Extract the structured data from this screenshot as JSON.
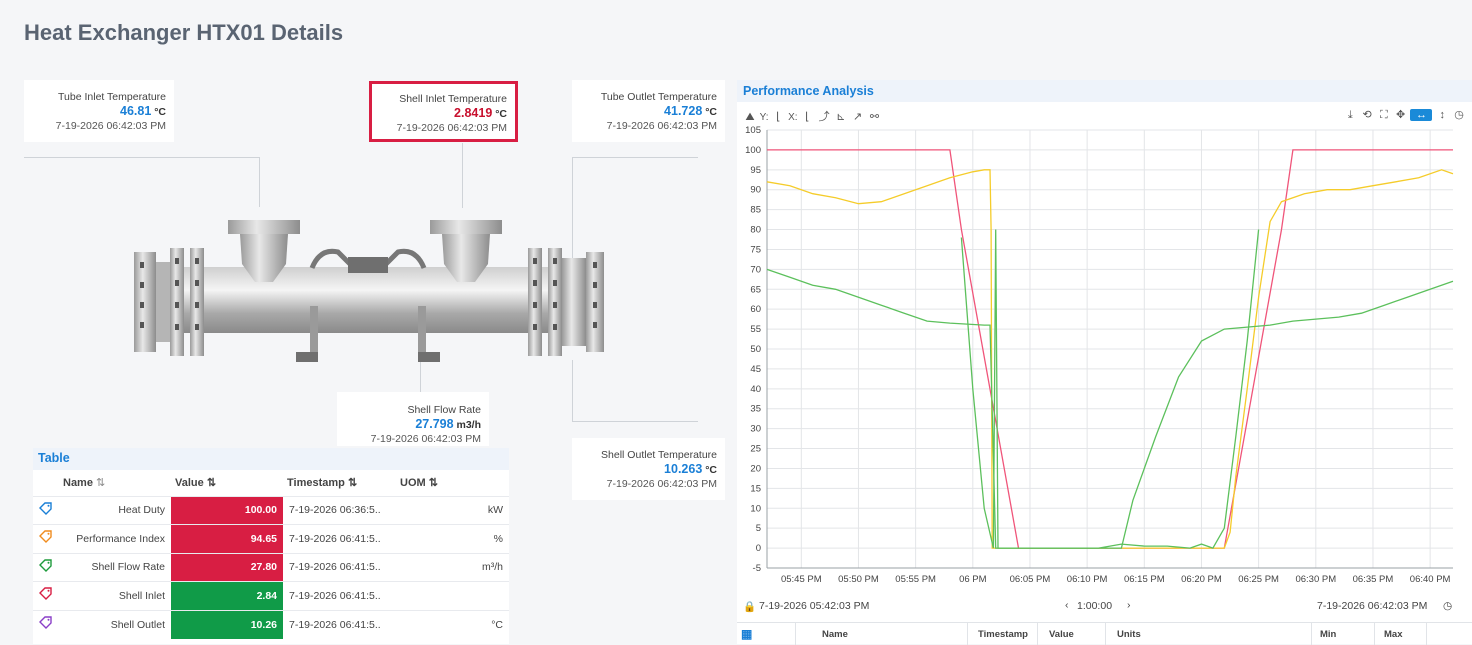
{
  "page": {
    "title": "Heat Exchanger HTX01 Details"
  },
  "callouts": {
    "tube_inlet": {
      "label": "Tube Inlet Temperature",
      "value": "46.81",
      "unit": "°C",
      "ts": "7-19-2026 06:42:03 PM"
    },
    "shell_inlet": {
      "label": "Shell Inlet Temperature",
      "value": "2.8419",
      "unit": "°C",
      "ts": "7-19-2026 06:42:03 PM"
    },
    "tube_outlet": {
      "label": "Tube Outlet Temperature",
      "value": "41.728",
      "unit": "°C",
      "ts": "7-19-2026 06:42:03 PM"
    },
    "shell_flow": {
      "label": "Shell Flow Rate",
      "value": "27.798",
      "unit": "m3/h",
      "ts": "7-19-2026 06:42:03 PM"
    },
    "shell_outlet": {
      "label": "Shell Outlet Temperature",
      "value": "10.263",
      "unit": "°C",
      "ts": "7-19-2026 06:42:03 PM"
    }
  },
  "table": {
    "title": "Table",
    "columns": {
      "name": "Name",
      "value": "Value",
      "timestamp": "Timestamp",
      "uom": "UOM"
    },
    "sort_icons": {
      "name": "⇅",
      "value": "⇅"
    },
    "rows": [
      {
        "name": "Heat Duty",
        "value": "100.00",
        "ts": "7-19-2026 06:36:5..",
        "uom": "kW",
        "status": "red",
        "tag_color": "#1a7fd6"
      },
      {
        "name": "Performance Index",
        "value": "94.65",
        "ts": "7-19-2026 06:41:5..",
        "uom": "%",
        "status": "red",
        "tag_color": "#f08c1e"
      },
      {
        "name": "Shell Flow Rate",
        "value": "27.80",
        "ts": "7-19-2026 06:41:5..",
        "uom": "m³/h",
        "status": "red",
        "tag_color": "#1e9b3c"
      },
      {
        "name": "Shell Inlet",
        "value": "2.84",
        "ts": "7-19-2026 06:41:5..",
        "uom": "",
        "status": "green",
        "tag_color": "#d81e43"
      },
      {
        "name": "Shell Outlet",
        "value": "10.26",
        "ts": "7-19-2026 06:41:5..",
        "uom": "°C",
        "status": "green",
        "tag_color": "#8a3fc8"
      }
    ]
  },
  "perf": {
    "title": "Performance Analysis",
    "toolbar": {
      "y_label": "Y:",
      "x_label": "X:"
    },
    "footer": {
      "start": "7-19-2026 05:42:03 PM",
      "range": "1:00:00",
      "end": "7-19-2026 06:42:03 PM"
    },
    "grid_headers": {
      "name": "Name",
      "timestamp": "Timestamp",
      "value": "Value",
      "units": "Units",
      "min": "Min",
      "max": "Max"
    }
  },
  "colors": {
    "accent": "#1a7fd6",
    "alarm": "#c8102e",
    "red": "#d81e43",
    "green": "#109b48",
    "pink_line": "#f0557a",
    "yellow_line": "#f5cc2a",
    "green_line": "#5cc05c"
  },
  "chart_data": {
    "type": "line",
    "title": "",
    "ylim": [
      -5,
      105
    ],
    "yticks": [
      "-5",
      "0",
      "5",
      "10",
      "15",
      "20",
      "25",
      "30",
      "35",
      "40",
      "45",
      "50",
      "55",
      "60",
      "65",
      "70",
      "75",
      "80",
      "85",
      "90",
      "95",
      "100",
      "105"
    ],
    "xticks": [
      "05:45 PM",
      "05:50 PM",
      "05:55 PM",
      "06 PM",
      "06:05 PM",
      "06:10 PM",
      "06:15 PM",
      "06:20 PM",
      "06:25 PM",
      "06:30 PM",
      "06:35 PM",
      "06:40 PM"
    ],
    "x_range_minutes": [
      42,
      102
    ],
    "grid": true,
    "series": [
      {
        "color": "#f0557a",
        "points": [
          [
            42,
            100
          ],
          [
            58,
            100
          ],
          [
            59,
            80
          ],
          [
            64,
            0
          ],
          [
            82,
            0
          ],
          [
            87,
            80
          ],
          [
            88,
            100
          ],
          [
            102,
            100
          ]
        ]
      },
      {
        "color": "#f5cc2a",
        "points": [
          [
            42,
            92
          ],
          [
            44,
            91
          ],
          [
            46,
            89
          ],
          [
            48,
            88
          ],
          [
            50,
            86.5
          ],
          [
            52,
            87
          ],
          [
            54,
            89
          ],
          [
            56,
            91
          ],
          [
            58,
            93
          ],
          [
            60,
            94.5
          ],
          [
            61,
            95
          ],
          [
            61.5,
            95
          ],
          [
            61.6,
            80
          ],
          [
            61.7,
            0
          ],
          [
            82,
            0
          ],
          [
            82.5,
            4
          ],
          [
            83,
            18
          ],
          [
            84,
            40
          ],
          [
            85,
            63
          ],
          [
            86,
            82
          ],
          [
            87,
            87
          ],
          [
            89,
            89
          ],
          [
            91,
            90
          ],
          [
            93,
            90
          ],
          [
            95,
            91
          ],
          [
            97,
            92
          ],
          [
            99,
            93
          ],
          [
            101,
            95
          ],
          [
            102,
            94
          ]
        ]
      },
      {
        "color": "#5cc05c",
        "points": [
          [
            42,
            70
          ],
          [
            44,
            68
          ],
          [
            46,
            66
          ],
          [
            48,
            65
          ],
          [
            50,
            63
          ],
          [
            52,
            61
          ],
          [
            54,
            59
          ],
          [
            56,
            57
          ],
          [
            58,
            56.5
          ],
          [
            61,
            56
          ],
          [
            61.5,
            56
          ],
          [
            62,
            0
          ],
          [
            66,
            0
          ],
          [
            71,
            0
          ],
          [
            73,
            0
          ],
          [
            74,
            12
          ],
          [
            76,
            28
          ],
          [
            78,
            43
          ],
          [
            80,
            52
          ],
          [
            82,
            55
          ],
          [
            84,
            55.5
          ],
          [
            86,
            56
          ],
          [
            88,
            57
          ],
          [
            90,
            57.5
          ],
          [
            92,
            58
          ],
          [
            94,
            59
          ],
          [
            96,
            61
          ],
          [
            98,
            63
          ],
          [
            100,
            65
          ],
          [
            102,
            67
          ]
        ]
      },
      {
        "color": "#5cc05c",
        "points": [
          [
            59,
            78
          ],
          [
            60,
            40
          ],
          [
            61,
            10
          ],
          [
            61.8,
            0
          ],
          [
            62,
            80
          ],
          [
            62.2,
            0
          ],
          [
            71,
            0
          ],
          [
            73,
            1
          ],
          [
            75,
            0.5
          ],
          [
            77,
            0.5
          ],
          [
            79,
            0
          ],
          [
            80,
            1
          ],
          [
            81,
            0
          ],
          [
            82,
            5
          ],
          [
            83,
            28
          ],
          [
            84,
            52
          ],
          [
            85,
            80
          ]
        ]
      }
    ]
  }
}
